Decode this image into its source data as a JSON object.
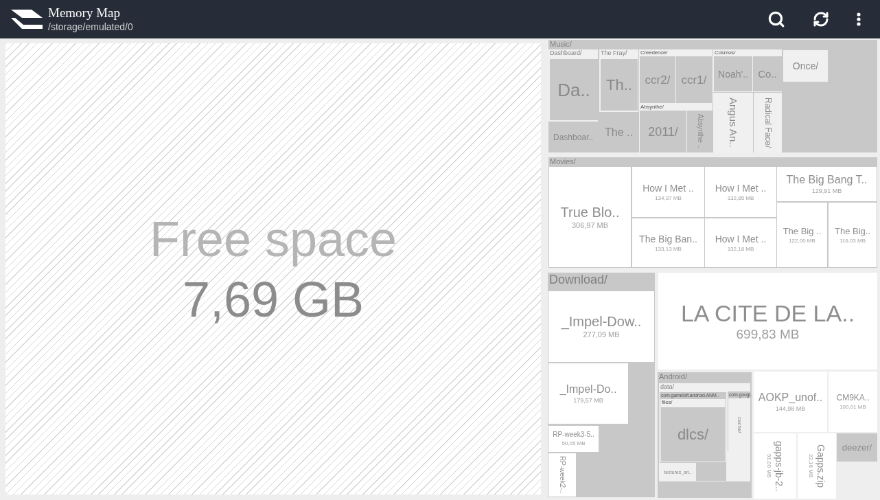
{
  "app_bar": {
    "title": "Memory Map",
    "path": "/storage/emulated/0"
  },
  "treemap": [
    {
      "kind": "free",
      "name": "Free space",
      "size": "7,69 GB"
    },
    {
      "kind": "folder",
      "name": "Music/",
      "children": [
        {
          "kind": "folder",
          "name": "Dashboard/",
          "children": [
            {
              "kind": "folder",
              "name": "Da.."
            },
            {
              "kind": "folder",
              "name": "Dashboar.."
            }
          ]
        },
        {
          "kind": "folder",
          "name": "The Fray/",
          "children": [
            {
              "kind": "folder",
              "name": "Th.."
            },
            {
              "kind": "folder",
              "name": "The .."
            }
          ]
        },
        {
          "kind": "folder",
          "name": "Creedence/",
          "children": [
            {
              "kind": "folder",
              "name": "ccr2/"
            },
            {
              "kind": "folder",
              "name": "ccr1/"
            }
          ]
        },
        {
          "kind": "folder",
          "name": "Absynthe/",
          "children": [
            {
              "kind": "folder",
              "name": "2011/"
            },
            {
              "kind": "folder",
              "name": "Absynthe .."
            }
          ]
        },
        {
          "kind": "folder",
          "name": "Cosmos/",
          "children": [
            {
              "kind": "folder",
              "name": "Noah'.."
            },
            {
              "kind": "folder",
              "name": "Co.."
            }
          ]
        },
        {
          "kind": "folder",
          "name": "Angus An.."
        },
        {
          "kind": "folder",
          "name": "Radical Face/"
        },
        {
          "kind": "folder",
          "name": "Once/"
        }
      ]
    },
    {
      "kind": "folder",
      "name": "Movies/",
      "children": [
        {
          "kind": "file",
          "name": "True Blo..",
          "size": "306,97 MB"
        },
        {
          "kind": "file",
          "name": "How I Met ..",
          "size": "134,37 MB"
        },
        {
          "kind": "file",
          "name": "The Big Ban..",
          "size": "133,13 MB"
        },
        {
          "kind": "file",
          "name": "How I Met ..",
          "size": "132,85 MB"
        },
        {
          "kind": "file",
          "name": "How I Met ..",
          "size": "132,18 MB"
        },
        {
          "kind": "file",
          "name": "The Big Bang T..",
          "size": "129,91 MB"
        },
        {
          "kind": "file",
          "name": "The Big ..",
          "size": "122,00 MB"
        },
        {
          "kind": "file",
          "name": "The Big..",
          "size": "116,03 MB"
        }
      ]
    },
    {
      "kind": "folder",
      "name": "Download/",
      "children": [
        {
          "kind": "file",
          "name": "_Impel-Dow..",
          "size": "277,09 MB"
        },
        {
          "kind": "file",
          "name": "_Impel-Do..",
          "size": "179,57 MB"
        },
        {
          "kind": "file",
          "name": "RP-week3-5..",
          "size": "50,05 MB"
        },
        {
          "kind": "file",
          "name": "RP-week2-.."
        }
      ]
    },
    {
      "kind": "file",
      "name": "LA CITE DE LA..",
      "size": "699,83 MB"
    },
    {
      "kind": "folder",
      "name": "Android/",
      "children": [
        {
          "kind": "folder",
          "name": "data/",
          "children": [
            {
              "kind": "folder",
              "name": "com.gameloft.android.ANM..",
              "children": [
                {
                  "kind": "folder",
                  "name": "files/",
                  "children": [
                    {
                      "kind": "folder",
                      "name": "dlcs/"
                    }
                  ]
                },
                {
                  "kind": "folder",
                  "name": "textures_an.."
                }
              ]
            },
            {
              "kind": "folder",
              "name": "com.googl..",
              "children": [
                {
                  "kind": "folder",
                  "name": "cache/"
                }
              ]
            }
          ]
        }
      ]
    },
    {
      "kind": "file",
      "name": "AOKP_unof..",
      "size": "144,98 MB"
    },
    {
      "kind": "file",
      "name": "CM9KA..",
      "size": "100,01 MB"
    },
    {
      "kind": "file",
      "name": "gapps-jb-2..",
      "size": "91,00 MB"
    },
    {
      "kind": "file",
      "name": "Gapps.zip",
      "size": "22,16 MB"
    },
    {
      "kind": "folder",
      "name": "deezer/"
    }
  ]
}
